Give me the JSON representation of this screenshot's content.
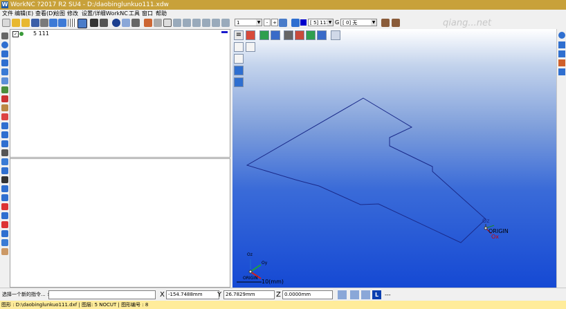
{
  "window": {
    "title": "WorkNC ?2017 R2 SU4 - D:/daobinglunkuo111.xdw",
    "app_logo": "W"
  },
  "menu": [
    "文件",
    "编辑(E)",
    "查看(D)",
    "绘图",
    "修改",
    "设置/详细",
    "WorkNC",
    "工具",
    "窗口",
    "帮助"
  ],
  "toolbar": {
    "layer_combo": "1",
    "minus_label": "-",
    "plus_label": "+",
    "level_combo": "[  5] 111",
    "group_label": "G",
    "group_combo": "[  0] 无"
  },
  "tree": {
    "item_label": "5 111",
    "checked": true
  },
  "viewport": {
    "origin_label": "ORIGIN",
    "ox_label": "Ox",
    "oz_label": "Oz",
    "small_axis": {
      "oz": "Oz",
      "oy": "Oy",
      "origin": "ORIGIN",
      "scale": "10(mm)"
    }
  },
  "status": {
    "command_prompt": "选择一个新的指令... ×",
    "command_value": "",
    "x_label": "X",
    "x_value": "-154.7488mm",
    "y_label": "Y",
    "y_value": "26.7829mm",
    "z_label": "Z",
    "z_value": "0.0000mm",
    "mode_badge": "L",
    "dash_label": "---"
  },
  "info": {
    "text": "图形 : D:\\daobinglunkuo111.dxf | 图层: 5 NOCUT | 图形编号 : 8"
  },
  "watermark": "qiang...net"
}
